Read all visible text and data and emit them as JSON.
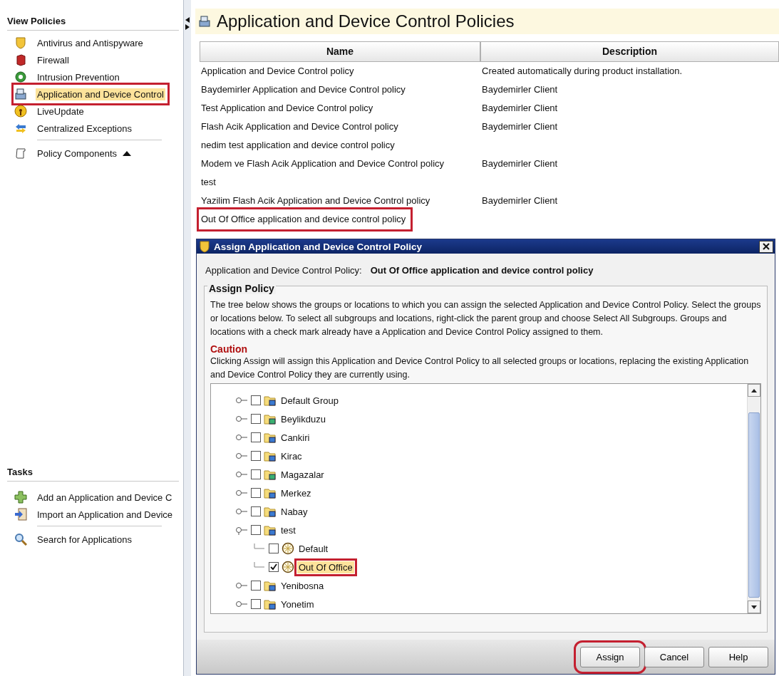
{
  "sidebar": {
    "view_policies": {
      "title": "View Policies",
      "items": [
        {
          "kind": "shield",
          "label": "Antivirus and Antispyware",
          "selected": false,
          "annotated": false
        },
        {
          "kind": "firewall",
          "label": "Firewall",
          "selected": false,
          "annotated": false
        },
        {
          "kind": "intrusion",
          "label": "Intrusion Prevention",
          "selected": false,
          "annotated": false
        },
        {
          "kind": "device",
          "label": "Application and Device Control",
          "selected": true,
          "annotated": true
        },
        {
          "kind": "update",
          "label": "LiveUpdate",
          "selected": false,
          "annotated": false
        },
        {
          "kind": "exceptions",
          "label": "Centralized Exceptions",
          "selected": false,
          "annotated": false
        }
      ],
      "components": {
        "label": "Policy Components"
      }
    },
    "tasks": {
      "title": "Tasks",
      "items": [
        {
          "kind": "add",
          "label": "Add an Application and Device C"
        },
        {
          "kind": "import",
          "label": "Import an Application and Device"
        },
        {
          "kind": "search",
          "label": "Search for Applications"
        }
      ]
    }
  },
  "main": {
    "title": "Application and Device Control Policies",
    "columns": [
      "Name",
      "Description"
    ],
    "rows": [
      {
        "name": "Application and Device Control policy",
        "description": "Created automatically during product installation.",
        "annotated": false
      },
      {
        "name": "Baydemirler Application and Device Control policy",
        "description": "Baydemirler Client",
        "annotated": false
      },
      {
        "name": "Test Application and Device Control policy",
        "description": "Baydemirler Client",
        "annotated": false
      },
      {
        "name": "Flash Acik Application and Device Control policy",
        "description": "Baydemirler Client",
        "annotated": false
      },
      {
        "name": "nedim test application and device control policy",
        "annotated": false
      },
      {
        "name": "Modem ve Flash Acik Application and Device Control policy",
        "description": "Baydemirler Client",
        "annotated": false
      },
      {
        "name": "test",
        "annotated": false
      },
      {
        "name": "Yazilim Flash Acik Application and Device Control policy",
        "description": "Baydemirler Client",
        "annotated": false
      },
      {
        "name": "Out Of Office application and device control policy",
        "annotated": true
      }
    ]
  },
  "dialog": {
    "title": "Assign Application and Device Control Policy",
    "policy_label": "Application and Device Control Policy:",
    "policy_value": "Out Of Office application and device control policy",
    "group_title": "Assign Policy",
    "description": "The tree below shows the groups or locations to which you can assign the selected Application and Device Control Policy. Select the groups or locations below. To select all subgroups and locations, right-click the parent group and choose Select All Subgroups. Groups and locations with a check mark already have a Application and Device Control Policy assigned to them.",
    "caution_title": "Caution",
    "caution_text": "Clicking Assign will assign this Application and Device Control Policy to all selected groups or locations, replacing the existing Application and Device Control Policy they are currently using.",
    "tree": [
      {
        "kind": "group",
        "label": "Default Group",
        "checked": false,
        "expanded": false,
        "selected": false,
        "annotated": false
      },
      {
        "kind": "group-ok",
        "label": "Beylikduzu",
        "checked": false,
        "expanded": false,
        "selected": false,
        "annotated": false
      },
      {
        "kind": "group",
        "label": "Cankiri",
        "checked": false,
        "expanded": false,
        "selected": false,
        "annotated": false
      },
      {
        "kind": "group",
        "label": "Kirac",
        "checked": false,
        "expanded": false,
        "selected": false,
        "annotated": false
      },
      {
        "kind": "group-ok",
        "label": "Magazalar",
        "checked": false,
        "expanded": false,
        "selected": false,
        "annotated": false
      },
      {
        "kind": "group",
        "label": "Merkez",
        "checked": false,
        "expanded": false,
        "selected": false,
        "annotated": false
      },
      {
        "kind": "group",
        "label": "Nabay",
        "checked": false,
        "expanded": false,
        "selected": false,
        "annotated": false
      },
      {
        "kind": "group",
        "label": "test",
        "checked": false,
        "expanded": true,
        "selected": false,
        "annotated": false,
        "children": [
          {
            "kind": "location",
            "label": "Default",
            "checked": false,
            "selected": false,
            "annotated": false
          },
          {
            "kind": "location",
            "label": "Out Of Office",
            "checked": true,
            "selected": true,
            "annotated": true
          }
        ]
      },
      {
        "kind": "group",
        "label": "Yenibosna",
        "checked": false,
        "expanded": false,
        "selected": false,
        "annotated": false
      },
      {
        "kind": "group",
        "label": "Yonetim",
        "checked": false,
        "expanded": false,
        "selected": false,
        "annotated": false
      }
    ],
    "buttons": [
      {
        "label": "Assign",
        "annotated": true
      },
      {
        "label": "Cancel",
        "annotated": false
      },
      {
        "label": "Help",
        "annotated": false
      }
    ]
  }
}
